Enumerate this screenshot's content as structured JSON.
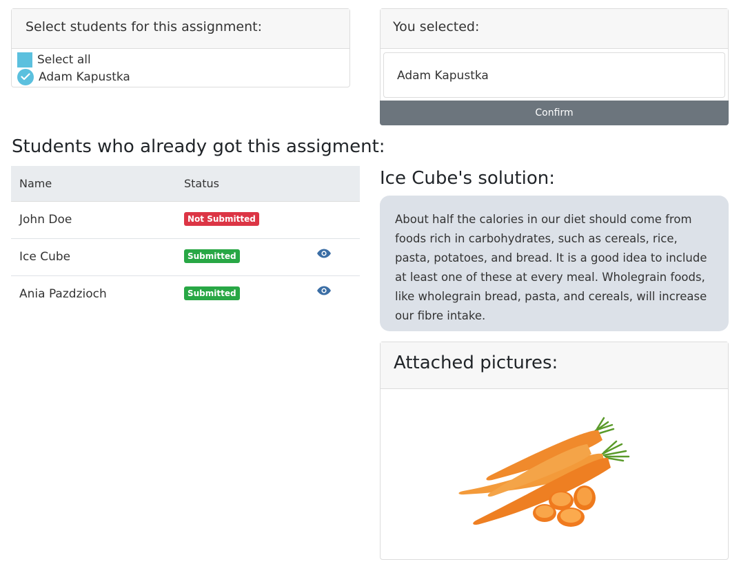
{
  "select_card": {
    "title": "Select students for this assignment:",
    "select_all_label": "Select all",
    "students": [
      "Adam Kapustka"
    ]
  },
  "selected_card": {
    "title": "You selected:",
    "selected_name": "Adam Kapustka",
    "confirm_label": "Confirm"
  },
  "students_section": {
    "heading": "Students who already got this assigment:",
    "columns": [
      "Name",
      "Status"
    ],
    "rows": [
      {
        "name": "John Doe",
        "status": "Not Submitted",
        "status_color": "#dc3545",
        "has_view": false
      },
      {
        "name": "Ice Cube",
        "status": "Submitted",
        "status_color": "#28a745",
        "has_view": true
      },
      {
        "name": "Ania Pazdzioch",
        "status": "Submitted",
        "status_color": "#28a745",
        "has_view": true
      }
    ]
  },
  "solution": {
    "heading": "Ice Cube's solution:",
    "text": "About half the calories in our diet should come from foods rich in carbohydrates, such as cereals, rice, pasta, potatoes, and bread. It is a good idea to include at least one of these at every meal. Wholegrain foods, like wholegrain bread, pasta, and cereals, will increase our fibre intake."
  },
  "pictures": {
    "title": "Attached pictures:",
    "image_subject": "carrots"
  },
  "colors": {
    "check_accent": "#5bc0de",
    "confirm_bg": "#6c757d",
    "eye_icon": "#3b6ea5",
    "solution_bg": "#dce1e8"
  }
}
